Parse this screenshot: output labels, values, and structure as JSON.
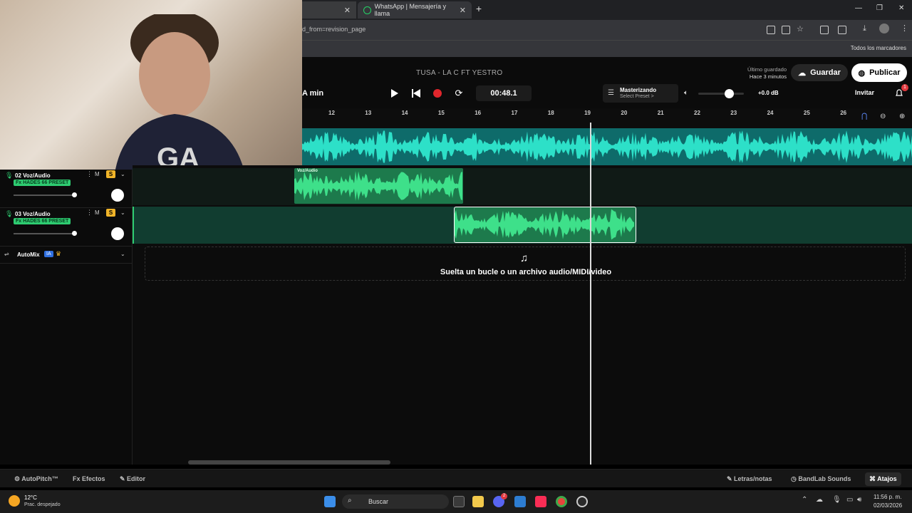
{
  "browser": {
    "tabs": [
      {
        "label": ""
      },
      {
        "label": "WhatsApp | Mensajería y llama"
      }
    ],
    "url_fragment": "d_from=revision_page",
    "bookmarks_label": "Todos los marcadores"
  },
  "daw": {
    "song_title": "TUSA - LA C FT YESTRO",
    "zoom_label": "A min",
    "time": "00:48.1",
    "mastering": {
      "title": "Masterizando",
      "subtitle": "Select Preset >"
    },
    "volume_db": "+0.0 dB",
    "last_saved_label": "Último guardado",
    "last_saved_time": "Hace 3 minutos",
    "save_label": "Guardar",
    "publish_label": "Publicar",
    "invite_label": "Invitar",
    "notification_count": "1",
    "ruler": [
      "12",
      "13",
      "14",
      "15",
      "16",
      "17",
      "18",
      "19",
      "20",
      "21",
      "22",
      "23",
      "24",
      "25",
      "26"
    ],
    "tracks": [
      {
        "name": "02 Voz/Audio",
        "fx": "Fx HADES 66 PRESET",
        "m": "M",
        "s": "S"
      },
      {
        "name": "03 Voz/Audio",
        "fx": "Fx HADES 66 PRESET",
        "m": "M",
        "s": "S"
      }
    ],
    "clip2_label": "Voz/Audio",
    "automix_label": "AutoMix",
    "ia_badge": "IA",
    "drop_text": "Suelta un bucle o un archivo audio/MIDI/video",
    "bottom": {
      "autopitch": "AutoPitch™",
      "effects": "Efectos",
      "editor": "Editor",
      "lyrics": "Letras/notas",
      "sounds": "BandLab Sounds",
      "shortcuts": "Atajos"
    }
  },
  "taskbar": {
    "temp": "12°C",
    "weather": "Prac. despejado",
    "search": "Buscar",
    "time": "11:56 p. m.",
    "date": "02/03/2026",
    "discord_badge": "2"
  },
  "colors": {
    "accent": "#2ecc71",
    "track1": "#0e6b6a",
    "waveform": "#2de0c8"
  }
}
